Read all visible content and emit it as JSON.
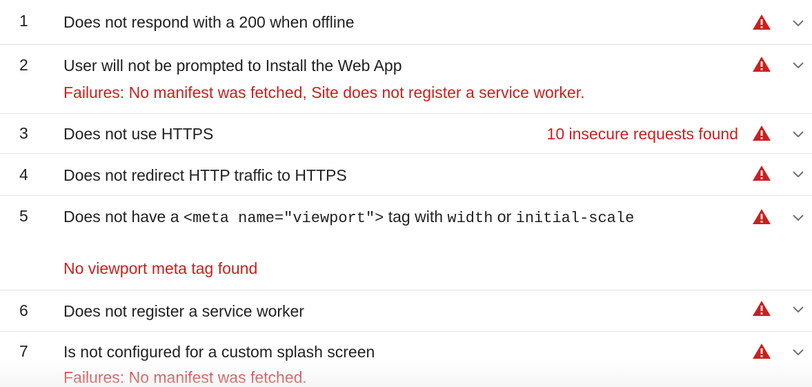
{
  "audits": [
    {
      "number": "1",
      "title": "Does not respond with a 200 when offline"
    },
    {
      "number": "2",
      "title": "User will not be prompted to Install the Web App",
      "failure": "Failures: No manifest was fetched, Site does not register a service worker."
    },
    {
      "number": "3",
      "title": "Does not use HTTPS",
      "display_value": "10 insecure requests found"
    },
    {
      "number": "4",
      "title": "Does not redirect HTTP traffic to HTTPS"
    },
    {
      "number": "5",
      "title_prefix": "Does not have a ",
      "title_code_1": "<meta name=\"viewport\">",
      "title_middle": " tag with ",
      "title_code_2": "width",
      "title_or": " or ",
      "title_code_3": "initial-scale",
      "failure": "No viewport meta tag found"
    },
    {
      "number": "6",
      "title": "Does not register a service worker"
    },
    {
      "number": "7",
      "title": "Is not configured for a custom splash screen",
      "failure": "Failures: No manifest was fetched."
    }
  ],
  "icons": {
    "status": "warning-triangle-icon",
    "expand": "chevron-down-icon"
  },
  "colors": {
    "fail": "#c7221f",
    "text": "#212121",
    "divider": "#e0e0e0"
  }
}
